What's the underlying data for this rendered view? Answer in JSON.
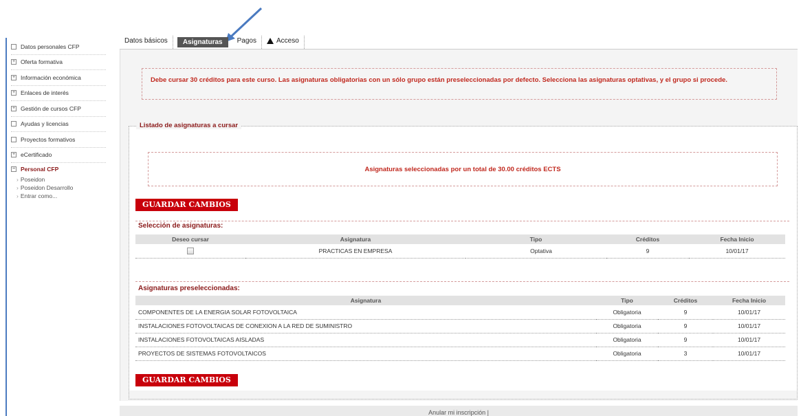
{
  "sidebar": {
    "items": [
      {
        "label": "Datos personales CFP",
        "icon": "square-icon",
        "symbol": ""
      },
      {
        "label": "Oferta formativa",
        "icon": "expand-icon",
        "symbol": "+"
      },
      {
        "label": "Información económica",
        "icon": "expand-icon",
        "symbol": "+"
      },
      {
        "label": "Enlaces de interés",
        "icon": "expand-icon",
        "symbol": "+"
      },
      {
        "label": "Gestión de cursos CFP",
        "icon": "expand-icon",
        "symbol": "+"
      },
      {
        "label": "Ayudas y licencias",
        "icon": "square-icon",
        "symbol": ""
      },
      {
        "label": "Proyectos formativos",
        "icon": "square-icon",
        "symbol": ""
      },
      {
        "label": "eCertificado",
        "icon": "expand-icon",
        "symbol": "+"
      }
    ],
    "active": {
      "label": "Personal CFP",
      "icon": "collapse-icon",
      "symbol": "−"
    },
    "subitems": [
      "Poseidon",
      "Poseidon Desarrollo",
      "Entrar como..."
    ]
  },
  "tabs": [
    {
      "label": "Datos básicos"
    },
    {
      "label": "Asignaturas"
    },
    {
      "label": "Pagos"
    },
    {
      "label": "Acceso",
      "icon": "warning-icon"
    }
  ],
  "notice": "Debe cursar 30 créditos para este curso. Las asignaturas obligatorias con un sólo grupo están preseleccionadas por defecto. Selecciona las asignaturas optativas, y el grupo si procede.",
  "listado": {
    "legend": "Listado de asignaturas a cursar",
    "total": "Asignaturas seleccionadas por un total de 30.00 créditos ECTS",
    "save_label": "GUARDAR CAMBIOS"
  },
  "seleccion": {
    "title": "Selección de asignaturas:",
    "headers": [
      "Deseo cursar",
      "Asignatura",
      "Tipo",
      "Créditos",
      "Fecha Inicio"
    ],
    "rows": [
      {
        "asignatura": "PRACTICAS EN EMPRESA",
        "tipo": "Optativa",
        "creditos": "9",
        "fecha": "10/01/17",
        "checked": false
      }
    ]
  },
  "preseleccionadas": {
    "title": "Asignaturas preseleccionadas:",
    "headers": [
      "Asignatura",
      "Tipo",
      "Créditos",
      "Fecha Inicio"
    ],
    "rows": [
      {
        "asignatura": "COMPONENTES DE LA ENERGIA SOLAR FOTOVOLTAICA",
        "tipo": "Obligatoria",
        "creditos": "9",
        "fecha": "10/01/17"
      },
      {
        "asignatura": "INSTALACIONES FOTOVOLTAICAS DE CONEXION A LA RED DE SUMINISTRO",
        "tipo": "Obligatoria",
        "creditos": "9",
        "fecha": "10/01/17"
      },
      {
        "asignatura": "INSTALACIONES FOTOVOLTAICAS AISLADAS",
        "tipo": "Obligatoria",
        "creditos": "9",
        "fecha": "10/01/17"
      },
      {
        "asignatura": "PROYECTOS DE SISTEMAS FOTOVOLTAICOS",
        "tipo": "Obligatoria",
        "creditos": "3",
        "fecha": "10/01/17"
      }
    ]
  },
  "footer": {
    "link": "Anular mi inscripción |"
  },
  "colors": {
    "accent_red": "#c8000b",
    "title_red": "#8b1a1a",
    "notice_red": "#c0281e",
    "arrow_blue": "#4a7ac0"
  }
}
